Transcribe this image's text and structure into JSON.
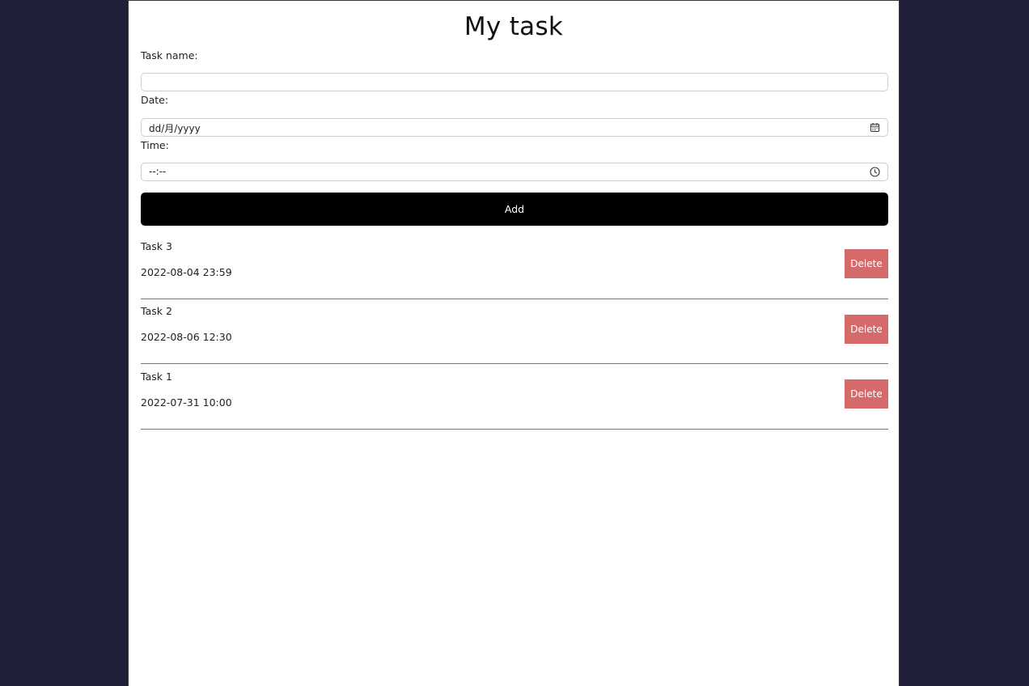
{
  "app": {
    "title": "My task"
  },
  "form": {
    "task_name_label": "Task name:",
    "task_name_value": "",
    "date_label": "Date:",
    "date_placeholder": "dd/月/yyyy",
    "time_label": "Time:",
    "time_placeholder": "--:--",
    "add_label": "Add"
  },
  "tasks": [
    {
      "name": "Task 3",
      "datetime": "2022-08-04 23:59",
      "delete_label": "Delete"
    },
    {
      "name": "Task 2",
      "datetime": "2022-08-06 12:30",
      "delete_label": "Delete"
    },
    {
      "name": "Task 1",
      "datetime": "2022-07-31 10:00",
      "delete_label": "Delete"
    }
  ],
  "colors": {
    "background": "#1f1f3a",
    "panel": "#ffffff",
    "add_button": "#000000",
    "delete_button": "#d46a6a",
    "divider": "#777777"
  },
  "icons": {
    "date": "calendar-icon",
    "time": "clock-icon"
  }
}
